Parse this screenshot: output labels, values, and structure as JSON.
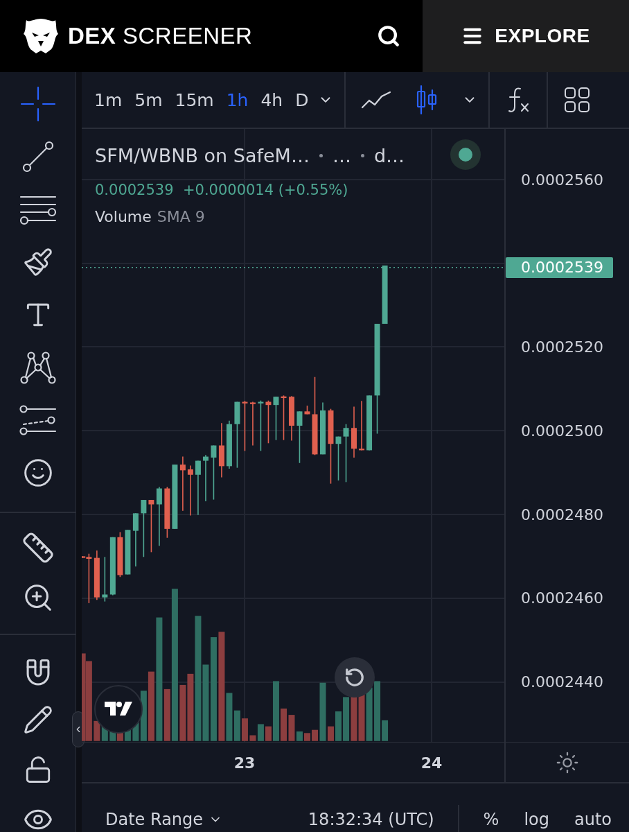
{
  "header": {
    "brand_bold": "DEX",
    "brand": "SCREENER",
    "explore": "EXPLORE"
  },
  "tool_groups": [
    [
      {
        "kind": "crosshair",
        "selected": true
      },
      {
        "kind": "trend",
        "selected": false
      },
      {
        "kind": "fib",
        "selected": false
      },
      {
        "kind": "brush",
        "selected": false
      },
      {
        "kind": "text",
        "selected": false
      },
      {
        "kind": "pattern",
        "selected": false
      },
      {
        "kind": "forecast",
        "selected": false
      },
      {
        "kind": "emoji",
        "selected": false
      }
    ],
    [
      {
        "kind": "ruler",
        "selected": false
      },
      {
        "kind": "zoom",
        "selected": false
      }
    ],
    [
      {
        "kind": "magnet",
        "selected": false
      },
      {
        "kind": "pencil",
        "selected": false
      },
      {
        "kind": "lock",
        "selected": false
      },
      {
        "kind": "eye",
        "selected": false
      }
    ]
  ],
  "timeframes": [
    {
      "label": "1m",
      "selected": false
    },
    {
      "label": "5m",
      "selected": false
    },
    {
      "label": "15m",
      "selected": false
    },
    {
      "label": "1h",
      "selected": true
    },
    {
      "label": "4h",
      "selected": false
    },
    {
      "label": "D",
      "selected": false
    }
  ],
  "chart_types": [
    {
      "kind": "line",
      "selected": false
    },
    {
      "kind": "candles",
      "selected": true
    }
  ],
  "legend": {
    "title": "SFM/WBNB on SafeM…",
    "parts": [
      "…",
      "d…"
    ],
    "price": "0.0002539",
    "change": "+0.0000014 (+0.55%)",
    "volume": "Volume",
    "volume_sma": "SMA 9"
  },
  "price_axis": {
    "ticks": [
      "0.0002560",
      "0.0002520",
      "0.0002500",
      "0.0002480",
      "0.0002460",
      "0.0002440"
    ],
    "last_price": "0.0002539"
  },
  "time_axis": [
    "23",
    "24"
  ],
  "bottom_bar": {
    "date_range": "Date Range",
    "time": "18:32:34 (UTC)",
    "toggles": [
      "%",
      "log",
      "auto"
    ]
  }
}
